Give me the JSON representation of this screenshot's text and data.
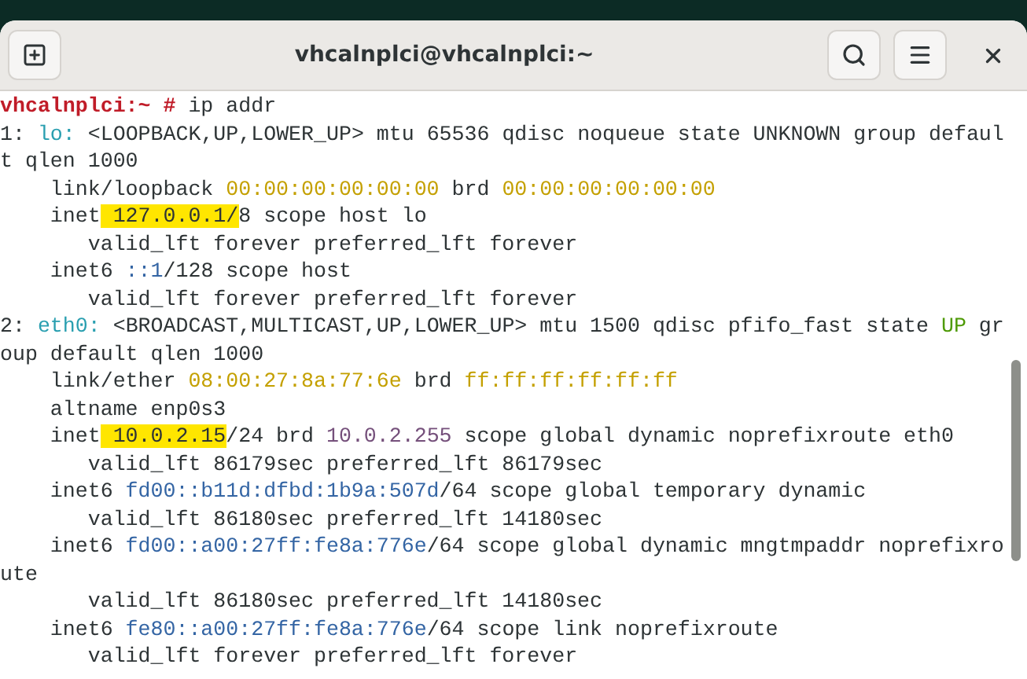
{
  "window": {
    "title": "vhcalnplci@vhcalnplci:~"
  },
  "terminal": {
    "lines": [
      {
        "segments": [
          {
            "text": "vhcalnplci:~ #",
            "kind": "prompt"
          },
          {
            "text": " ip addr",
            "kind": "plain"
          }
        ]
      },
      {
        "segments": [
          {
            "text": "1: ",
            "kind": "plain"
          },
          {
            "text": "lo:",
            "kind": "iface"
          },
          {
            "text": " <LOOPBACK,UP,LOWER_UP> mtu 65536 qdisc noqueue state UNKNOWN group defaul",
            "kind": "plain"
          }
        ]
      },
      {
        "segments": [
          {
            "text": "t qlen 1000",
            "kind": "plain"
          }
        ]
      },
      {
        "segments": [
          {
            "text": "    link/loopback ",
            "kind": "plain"
          },
          {
            "text": "00:00:00:00:00:00",
            "kind": "mac"
          },
          {
            "text": " brd ",
            "kind": "plain"
          },
          {
            "text": "00:00:00:00:00:00",
            "kind": "mac"
          }
        ]
      },
      {
        "segments": [
          {
            "text": "    inet",
            "kind": "plain"
          },
          {
            "text": " 127.0.0.1/",
            "kind": "highlight"
          },
          {
            "text": "8 scope host lo",
            "kind": "plain"
          }
        ]
      },
      {
        "segments": [
          {
            "text": "       valid_lft forever preferred_lft forever",
            "kind": "plain"
          }
        ]
      },
      {
        "segments": [
          {
            "text": "    inet6 ",
            "kind": "plain"
          },
          {
            "text": "::1",
            "kind": "ipv6"
          },
          {
            "text": "/128 scope host",
            "kind": "plain"
          }
        ]
      },
      {
        "segments": [
          {
            "text": "       valid_lft forever preferred_lft forever",
            "kind": "plain"
          }
        ]
      },
      {
        "segments": [
          {
            "text": "2: ",
            "kind": "plain"
          },
          {
            "text": "eth0:",
            "kind": "iface"
          },
          {
            "text": " <BROADCAST,MULTICAST,UP,LOWER_UP> mtu 1500 qdisc pfifo_fast state ",
            "kind": "plain"
          },
          {
            "text": "UP",
            "kind": "state"
          },
          {
            "text": " gr",
            "kind": "plain"
          }
        ]
      },
      {
        "segments": [
          {
            "text": "oup default qlen 1000",
            "kind": "plain"
          }
        ]
      },
      {
        "segments": [
          {
            "text": "    link/ether ",
            "kind": "plain"
          },
          {
            "text": "08:00:27:8a:77:6e",
            "kind": "mac"
          },
          {
            "text": " brd ",
            "kind": "plain"
          },
          {
            "text": "ff:ff:ff:ff:ff:ff",
            "kind": "mac"
          }
        ]
      },
      {
        "segments": [
          {
            "text": "    altname enp0s3",
            "kind": "plain"
          }
        ]
      },
      {
        "segments": [
          {
            "text": "    inet",
            "kind": "plain"
          },
          {
            "text": " 10.0.2.15",
            "kind": "highlight"
          },
          {
            "text": "/24 brd ",
            "kind": "plain"
          },
          {
            "text": "10.0.2.255",
            "kind": "brd"
          },
          {
            "text": " scope global dynamic noprefixroute eth0",
            "kind": "plain"
          }
        ]
      },
      {
        "segments": [
          {
            "text": "       valid_lft 86179sec preferred_lft 86179sec",
            "kind": "plain"
          }
        ]
      },
      {
        "segments": [
          {
            "text": "    inet6 ",
            "kind": "plain"
          },
          {
            "text": "fd00::b11d:dfbd:1b9a:507d",
            "kind": "ipv6"
          },
          {
            "text": "/64 scope global temporary dynamic",
            "kind": "plain"
          }
        ]
      },
      {
        "segments": [
          {
            "text": "       valid_lft 86180sec preferred_lft 14180sec",
            "kind": "plain"
          }
        ]
      },
      {
        "segments": [
          {
            "text": "    inet6 ",
            "kind": "plain"
          },
          {
            "text": "fd00::a00:27ff:fe8a:776e",
            "kind": "ipv6"
          },
          {
            "text": "/64 scope global dynamic mngtmpaddr noprefixro",
            "kind": "plain"
          }
        ]
      },
      {
        "segments": [
          {
            "text": "ute",
            "kind": "plain"
          }
        ]
      },
      {
        "segments": [
          {
            "text": "       valid_lft 86180sec preferred_lft 14180sec",
            "kind": "plain"
          }
        ]
      },
      {
        "segments": [
          {
            "text": "    inet6 ",
            "kind": "plain"
          },
          {
            "text": "fe80::a00:27ff:fe8a:776e",
            "kind": "ipv6"
          },
          {
            "text": "/64 scope link noprefixroute",
            "kind": "plain"
          }
        ]
      },
      {
        "segments": [
          {
            "text": "       valid_lft forever preferred_lft forever",
            "kind": "plain"
          }
        ]
      }
    ]
  }
}
